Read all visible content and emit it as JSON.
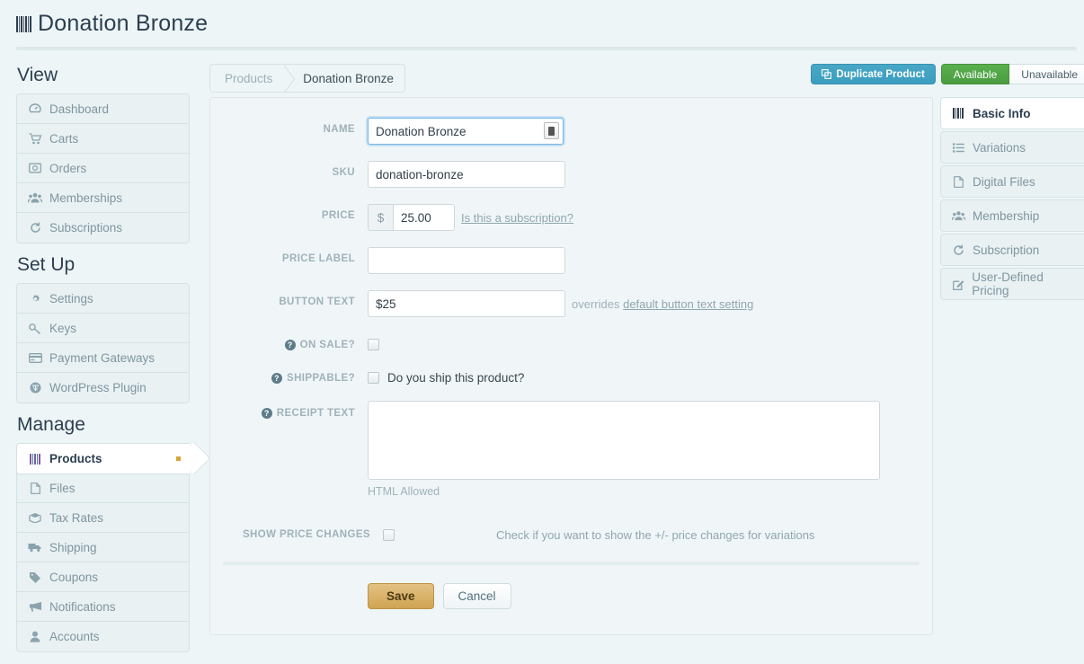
{
  "header": {
    "title": "Donation Bronze",
    "title_icon": "barcode-icon"
  },
  "sidebar": {
    "groups": [
      {
        "heading": "View",
        "items": [
          {
            "label": "Dashboard",
            "icon": "dashboard-icon"
          },
          {
            "label": "Carts",
            "icon": "cart-icon"
          },
          {
            "label": "Orders",
            "icon": "orders-icon"
          },
          {
            "label": "Memberships",
            "icon": "users-icon"
          },
          {
            "label": "Subscriptions",
            "icon": "refresh-icon"
          }
        ]
      },
      {
        "heading": "Set Up",
        "items": [
          {
            "label": "Settings",
            "icon": "gear-icon"
          },
          {
            "label": "Keys",
            "icon": "key-icon"
          },
          {
            "label": "Payment Gateways",
            "icon": "credit-card-icon"
          },
          {
            "label": "WordPress Plugin",
            "icon": "wordpress-icon"
          }
        ]
      },
      {
        "heading": "Manage",
        "items": [
          {
            "label": "Products",
            "icon": "barcode-icon",
            "active": true
          },
          {
            "label": "Files",
            "icon": "file-icon"
          },
          {
            "label": "Tax Rates",
            "icon": "tax-icon"
          },
          {
            "label": "Shipping",
            "icon": "truck-icon"
          },
          {
            "label": "Coupons",
            "icon": "tag-icon"
          },
          {
            "label": "Notifications",
            "icon": "megaphone-icon"
          },
          {
            "label": "Accounts",
            "icon": "user-icon"
          }
        ]
      }
    ]
  },
  "breadcrumb": {
    "parent": "Products",
    "current": "Donation Bronze"
  },
  "topbar_actions": {
    "duplicate_label": "Duplicate Product",
    "duplicate_icon": "copy-icon",
    "available_label": "Available",
    "unavailable_label": "Unavailable",
    "available_active": true,
    "available_color": "#4a9d40",
    "duplicate_color": "#3b9ec0"
  },
  "form": {
    "name": {
      "label": "NAME",
      "value": "Donation Bronze",
      "placeholder": ""
    },
    "sku": {
      "label": "SKU",
      "value": "donation-bronze",
      "placeholder": ""
    },
    "price": {
      "label": "PRICE",
      "currency": "$",
      "value": "25.00",
      "hint": "Is this a subscription?"
    },
    "price_label": {
      "label": "PRICE LABEL",
      "value": "",
      "placeholder": ""
    },
    "button_text": {
      "label": "BUTTON TEXT",
      "value": "$25",
      "hint_prefix": "overrides",
      "hint_link": "default button text setting"
    },
    "on_sale": {
      "label": "ON SALE?",
      "help": "?",
      "checked": false
    },
    "shippable": {
      "label": "SHIPPABLE?",
      "help": "?",
      "checked": false,
      "text": "Do you ship this product?"
    },
    "receipt_text": {
      "label": "RECEIPT TEXT",
      "help": "?",
      "value": "",
      "note": "HTML Allowed"
    },
    "show_price_changes": {
      "label": "SHOW PRICE CHANGES",
      "checked": false,
      "note": "Check if you want to show the +/- price changes for variations"
    },
    "save_label": "Save",
    "cancel_label": "Cancel",
    "save_color": "#cfa351"
  },
  "tabs": [
    {
      "label": "Basic Info",
      "icon": "barcode-icon",
      "active": true
    },
    {
      "label": "Variations",
      "icon": "list-icon",
      "active": false
    },
    {
      "label": "Digital Files",
      "icon": "file-icon",
      "active": false
    },
    {
      "label": "Membership",
      "icon": "users-icon",
      "active": false
    },
    {
      "label": "Subscription",
      "icon": "refresh-icon",
      "active": false
    },
    {
      "label": "User-Defined Pricing",
      "icon": "edit-icon",
      "active": false
    }
  ]
}
